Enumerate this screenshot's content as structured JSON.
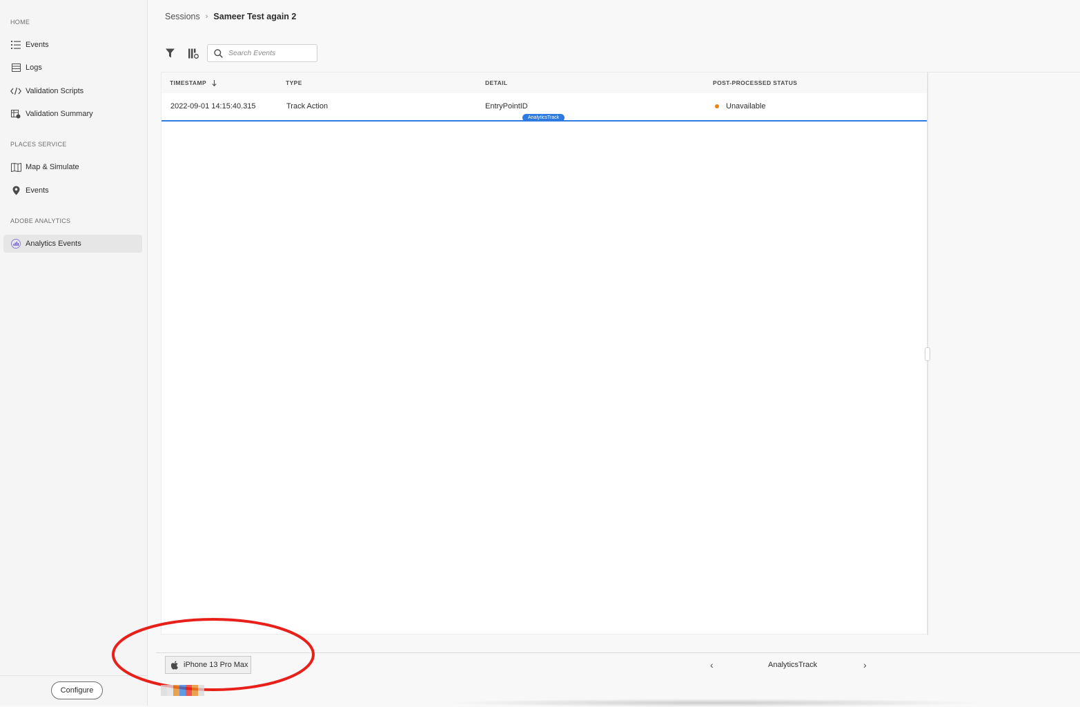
{
  "sidebar": {
    "sections": {
      "home": "HOME",
      "places": "PLACES SERVICE",
      "analytics": "ADOBE ANALYTICS"
    },
    "items": {
      "events": "Events",
      "logs": "Logs",
      "validation_scripts": "Validation Scripts",
      "validation_summary": "Validation Summary",
      "map_simulate": "Map & Simulate",
      "places_events": "Events",
      "analytics_events": "Analytics Events"
    },
    "configure_label": "Configure"
  },
  "breadcrumb": {
    "parent": "Sessions",
    "separator": "›",
    "current": "Sameer Test again 2"
  },
  "search": {
    "placeholder": "Search Events"
  },
  "table": {
    "headers": {
      "timestamp": "TIMESTAMP",
      "type": "TYPE",
      "detail": "DETAIL",
      "status": "POST-PROCESSED STATUS"
    },
    "sort": {
      "column": "timestamp",
      "direction": "descending"
    },
    "rows": [
      {
        "timestamp": "2022-09-01 14:15:40.315",
        "type": "Track Action",
        "detail": "EntryPointID",
        "tag": "AnalyticsTrack",
        "status": "Unavailable",
        "status_color": "#e68619"
      }
    ]
  },
  "footer": {
    "device": "iPhone 13 Pro Max",
    "device_icon": "apple-icon",
    "pager_label": "AnalyticsTrack"
  },
  "colors": {
    "accent": "#2d7be0",
    "annotation": "#e8201a",
    "warning": "#e68619"
  }
}
